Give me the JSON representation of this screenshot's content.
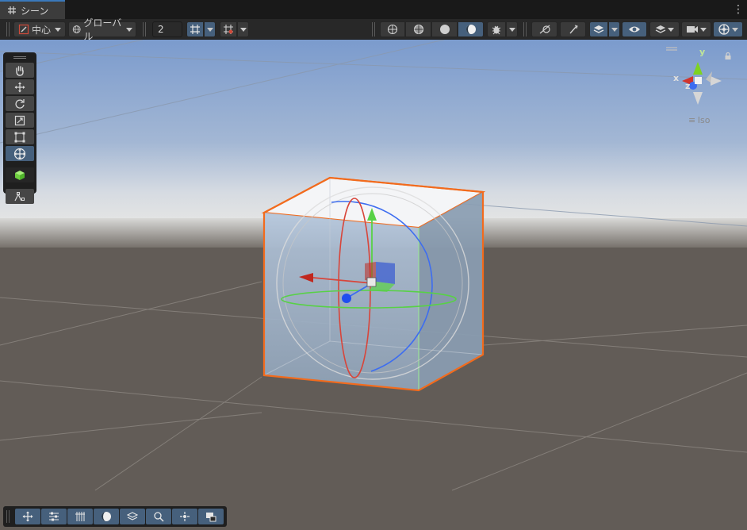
{
  "tabbar": {
    "scene_tab_label": "シーン",
    "menu_glyph": "⋮"
  },
  "toolbar": {
    "pivot_label": "中心",
    "space_label": "グローバル",
    "grid_size_value": "2",
    "draw_mode_buttons": [
      "wireframe-shading",
      "shaded-wireframe",
      "shaded",
      "lit-shaded"
    ],
    "active_shading": "lit-shaded"
  },
  "tool_palette": {
    "tools": [
      "view-tool",
      "move-tool",
      "rotate-tool",
      "scale-tool",
      "rect-tool",
      "transform-tool",
      "custom-editor-tool",
      "component-tool"
    ],
    "active_tool": "transform-tool"
  },
  "gizmo": {
    "y_label": "y",
    "x_label": "x",
    "z_label": "z",
    "projection_label": "Iso",
    "lock_glyph": "🔒"
  },
  "bottom_bar": {
    "buttons": [
      "move-overlay",
      "tool-settings",
      "grid-overlay",
      "lighting-overlay",
      "layers-overlay",
      "search-overlay",
      "snap-overlay",
      "camera-overlay"
    ]
  },
  "colors": {
    "accent": "#46607c",
    "selection_outline": "#f26b1d",
    "axis_x": "#d2342d",
    "axis_y": "#7ed321",
    "axis_z": "#2f6cf0",
    "sky_top": "#7f9fcf",
    "ground": "#625c57"
  }
}
